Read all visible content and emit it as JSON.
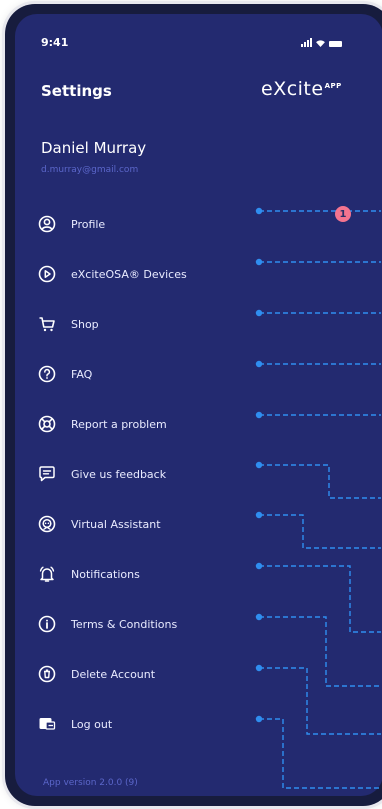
{
  "status_bar": {
    "time": "9:41"
  },
  "header": {
    "title": "Settings",
    "brand": "eXcite",
    "brand_suffix": "APP"
  },
  "user": {
    "name": "Daniel Murray",
    "email": "d.murray@gmail.com"
  },
  "menu": {
    "items": [
      {
        "label": "Profile",
        "icon": "user-circle-icon"
      },
      {
        "label": "eXciteOSA® Devices",
        "icon": "play-circle-icon"
      },
      {
        "label": "Shop",
        "icon": "shopping-cart-icon"
      },
      {
        "label": "FAQ",
        "icon": "question-circle-icon"
      },
      {
        "label": "Report a problem",
        "icon": "lifebuoy-icon"
      },
      {
        "label": "Give us feedback",
        "icon": "chat-bubble-icon"
      },
      {
        "label": "Virtual Assistant",
        "icon": "assistant-icon"
      },
      {
        "label": "Notifications",
        "icon": "bell-icon"
      },
      {
        "label": "Terms & Conditions",
        "icon": "info-circle-icon"
      },
      {
        "label": "Delete Account",
        "icon": "trash-icon"
      },
      {
        "label": "Log out",
        "icon": "logout-icon"
      }
    ]
  },
  "annotation": {
    "badge": "1",
    "badge_color": "#f4748f",
    "line_color": "#2f8ef0"
  },
  "footer": {
    "version": "App version 2.0.0 (9)"
  },
  "colors": {
    "screen_bg": "#232a70",
    "phone_frame": "#171c3e",
    "text": "#ffffff",
    "muted": "#5b66c9"
  }
}
